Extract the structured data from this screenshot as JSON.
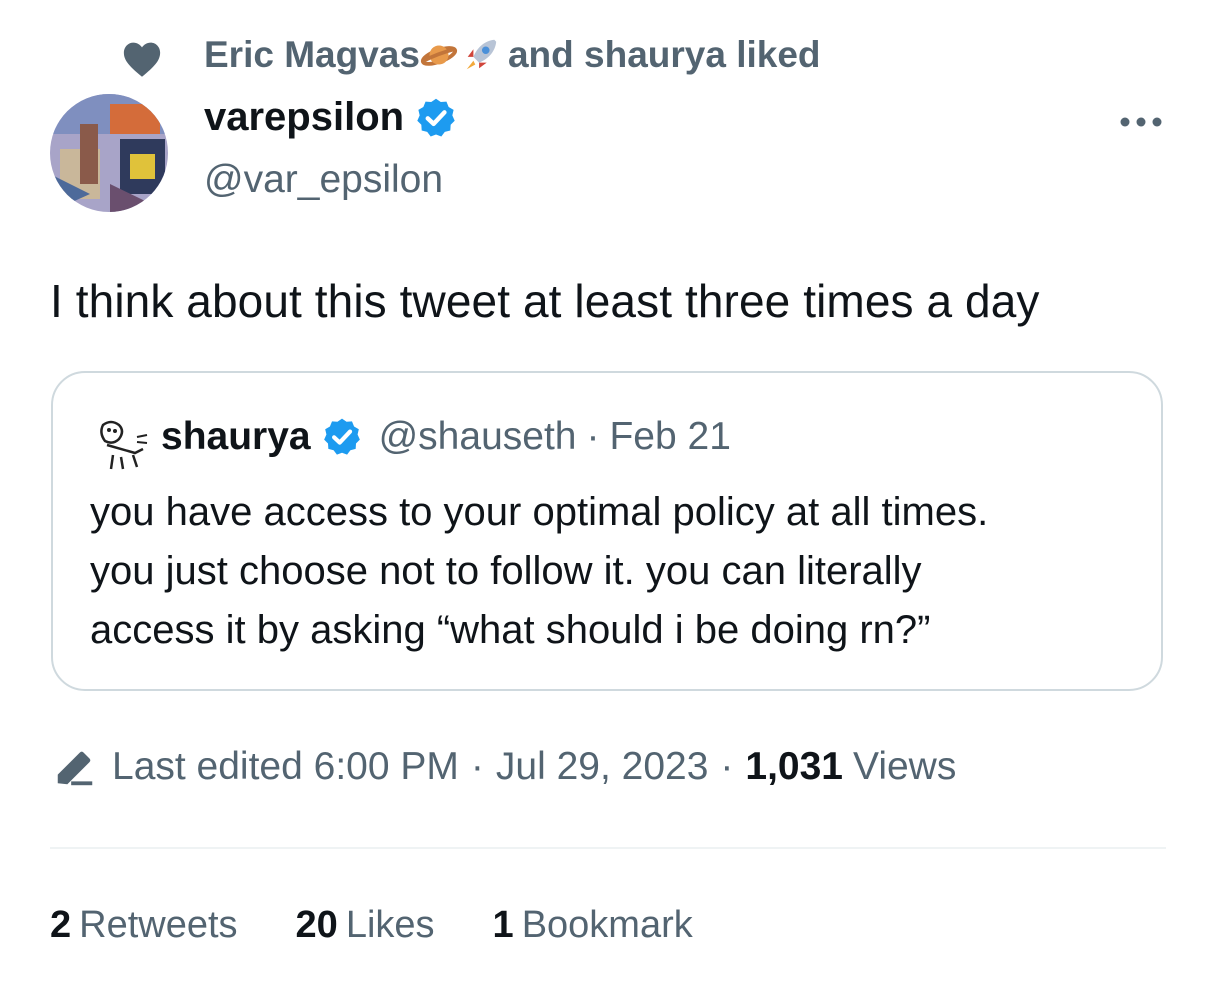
{
  "social_context": {
    "name": "Eric Magvas",
    "emojis": [
      "ringed-planet-emoji",
      "rocket-emoji"
    ],
    "suffix": "and shaurya liked"
  },
  "author": {
    "display_name": "varepsilon",
    "handle": "@var_epsilon",
    "verified": true
  },
  "tweet": {
    "text": "I think about this tweet at least three times a day"
  },
  "quoted_tweet": {
    "display_name": "shaurya",
    "handle": "@shauseth",
    "separator": "·",
    "date": "Feb 21",
    "lines": [
      "you have access to your optimal policy at all times.",
      "you just choose not to follow it. you can literally",
      "access it by asking “what should i be doing rn?”"
    ]
  },
  "meta": {
    "edited_label": "Last edited 6:00 PM",
    "separator": "·",
    "date": "Jul 29, 2023",
    "views_count": "1,031",
    "views_label": "Views"
  },
  "stats": {
    "retweets_count": "2",
    "retweets_label": "Retweets",
    "likes_count": "20",
    "likes_label": "Likes",
    "bookmarks_count": "1",
    "bookmarks_label": "Bookmark"
  },
  "colors": {
    "primary_text": "#0f1419",
    "secondary_text": "#536471",
    "verified_blue": "#1d9bf0",
    "border": "#cfd9de"
  }
}
